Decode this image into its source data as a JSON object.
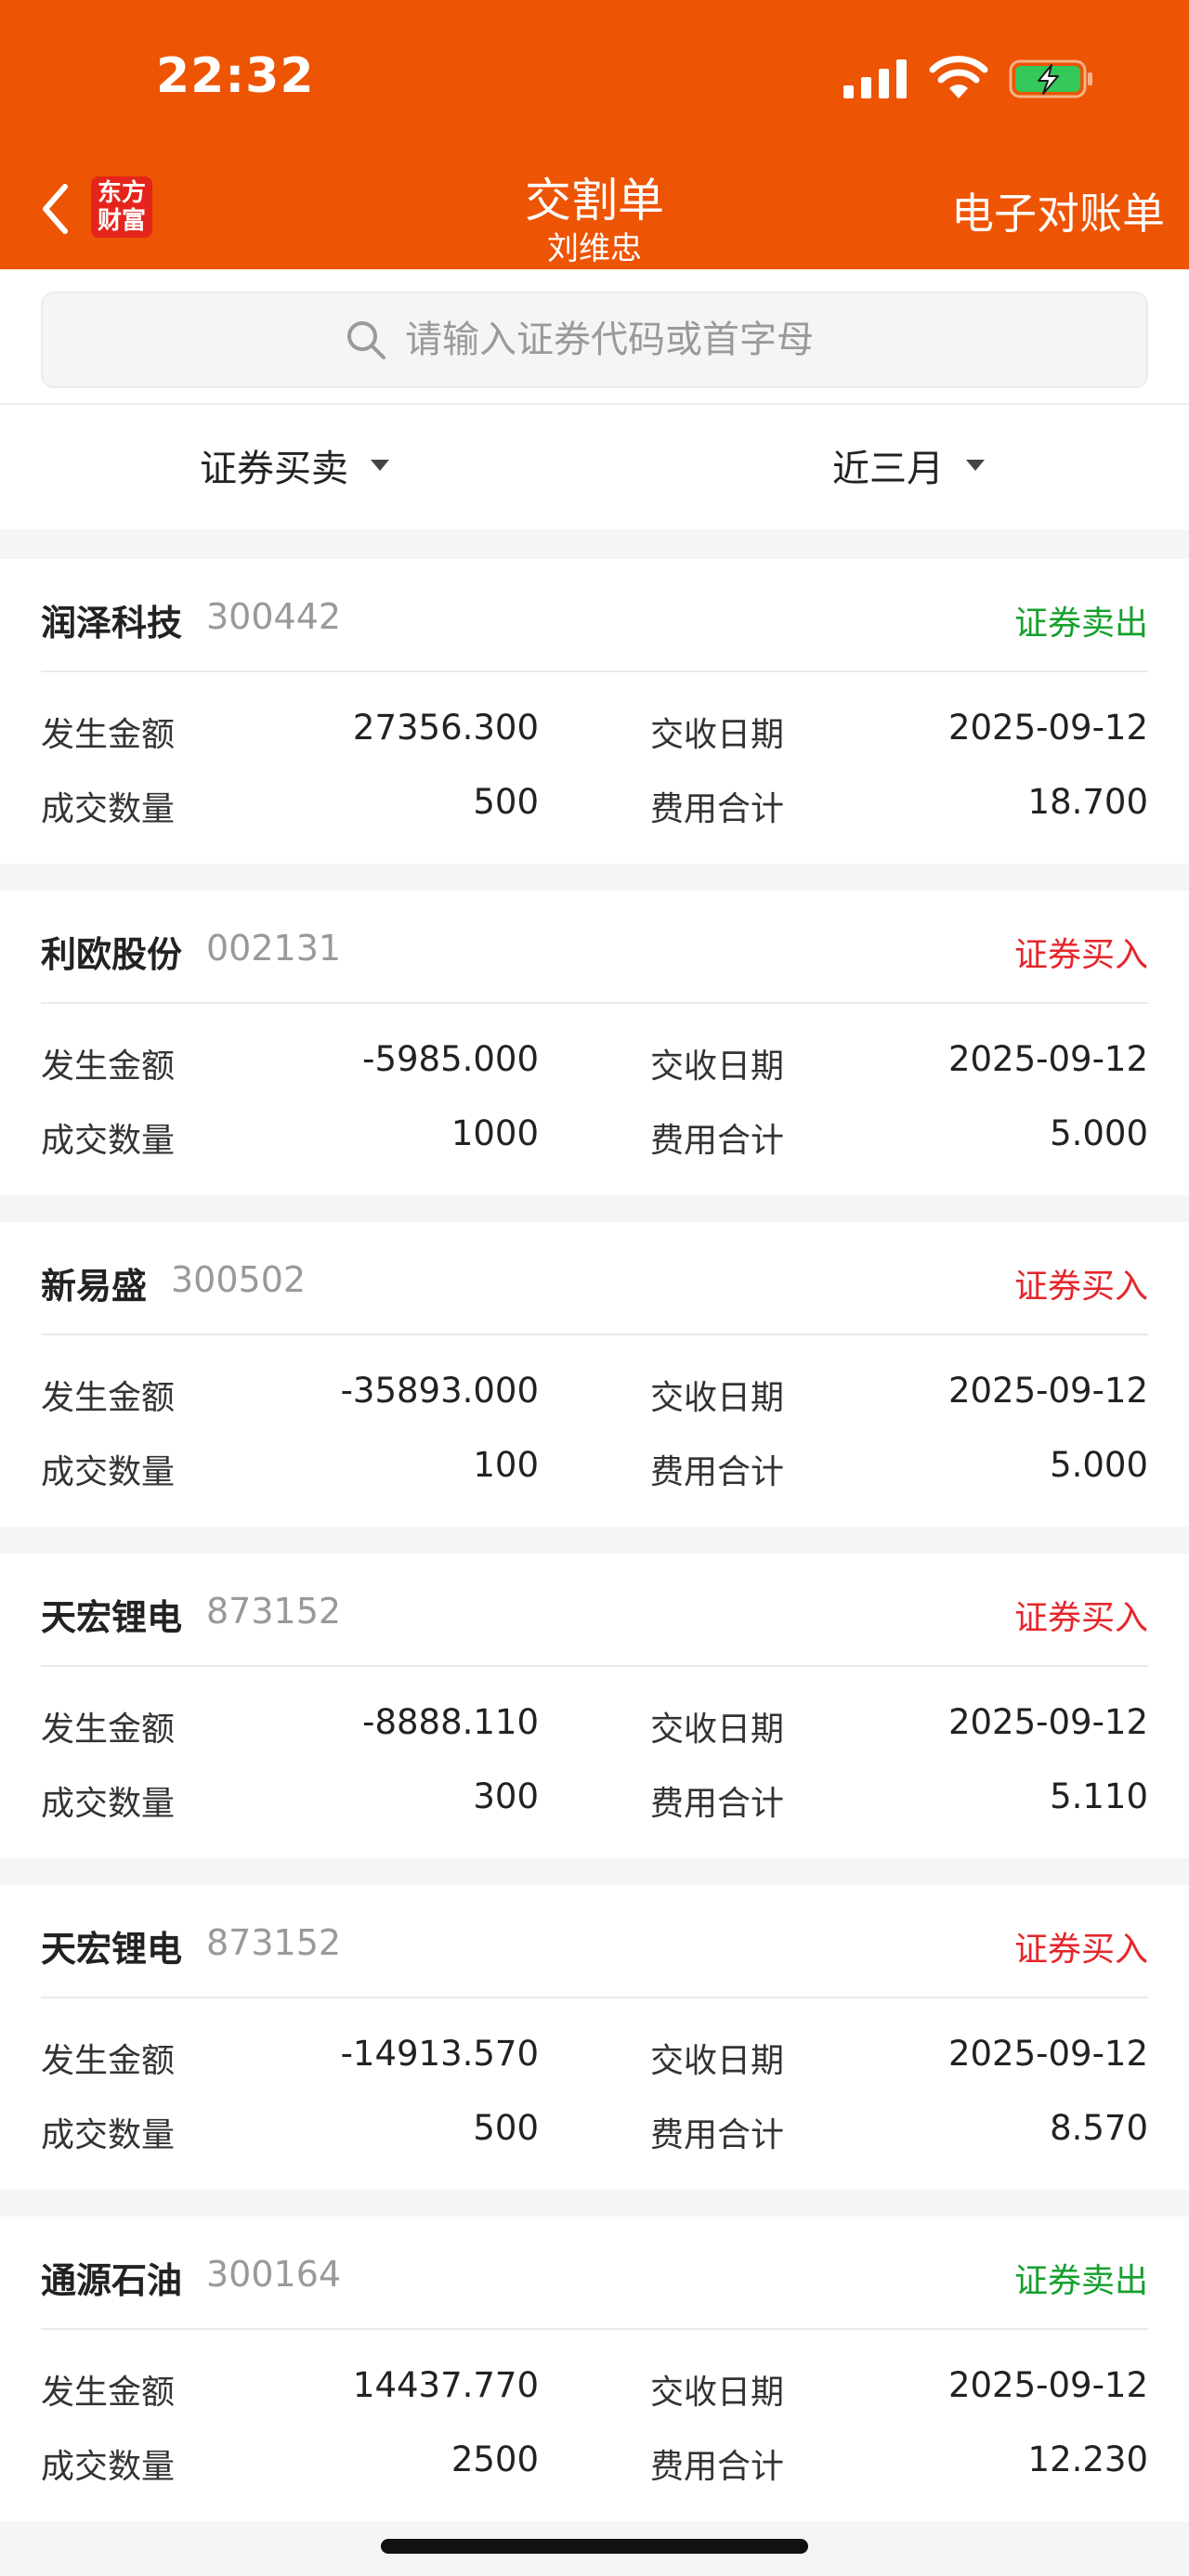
{
  "status_bar": {
    "time": "22:32"
  },
  "header": {
    "logo_line1": "东方",
    "logo_line2": "财富",
    "title": "交割单",
    "subtitle": "刘维忠",
    "e_statement": "电子对账单"
  },
  "search": {
    "placeholder": "请输入证券代码或首字母"
  },
  "filters": {
    "type": "证券买卖",
    "range": "近三月"
  },
  "labels": {
    "amount": "发生金额",
    "quantity": "成交数量",
    "settle_date": "交收日期",
    "fee": "费用合计"
  },
  "colors": {
    "brand": "#ed5404",
    "sell": "#14a02c",
    "buy": "#e5262b"
  },
  "records": [
    {
      "name": "润泽科技",
      "code": "300442",
      "type": "证券卖出",
      "side": "sell",
      "amount": "27356.300",
      "quantity": "500",
      "date": "2025-09-12",
      "fee": "18.700"
    },
    {
      "name": "利欧股份",
      "code": "002131",
      "type": "证券买入",
      "side": "buy",
      "amount": "-5985.000",
      "quantity": "1000",
      "date": "2025-09-12",
      "fee": "5.000"
    },
    {
      "name": "新易盛",
      "code": "300502",
      "type": "证券买入",
      "side": "buy",
      "amount": "-35893.000",
      "quantity": "100",
      "date": "2025-09-12",
      "fee": "5.000"
    },
    {
      "name": "天宏锂电",
      "code": "873152",
      "type": "证券买入",
      "side": "buy",
      "amount": "-8888.110",
      "quantity": "300",
      "date": "2025-09-12",
      "fee": "5.110"
    },
    {
      "name": "天宏锂电",
      "code": "873152",
      "type": "证券买入",
      "side": "buy",
      "amount": "-14913.570",
      "quantity": "500",
      "date": "2025-09-12",
      "fee": "8.570"
    },
    {
      "name": "通源石油",
      "code": "300164",
      "type": "证券卖出",
      "side": "sell",
      "amount": "14437.770",
      "quantity": "2500",
      "date": "2025-09-12",
      "fee": "12.230"
    }
  ]
}
